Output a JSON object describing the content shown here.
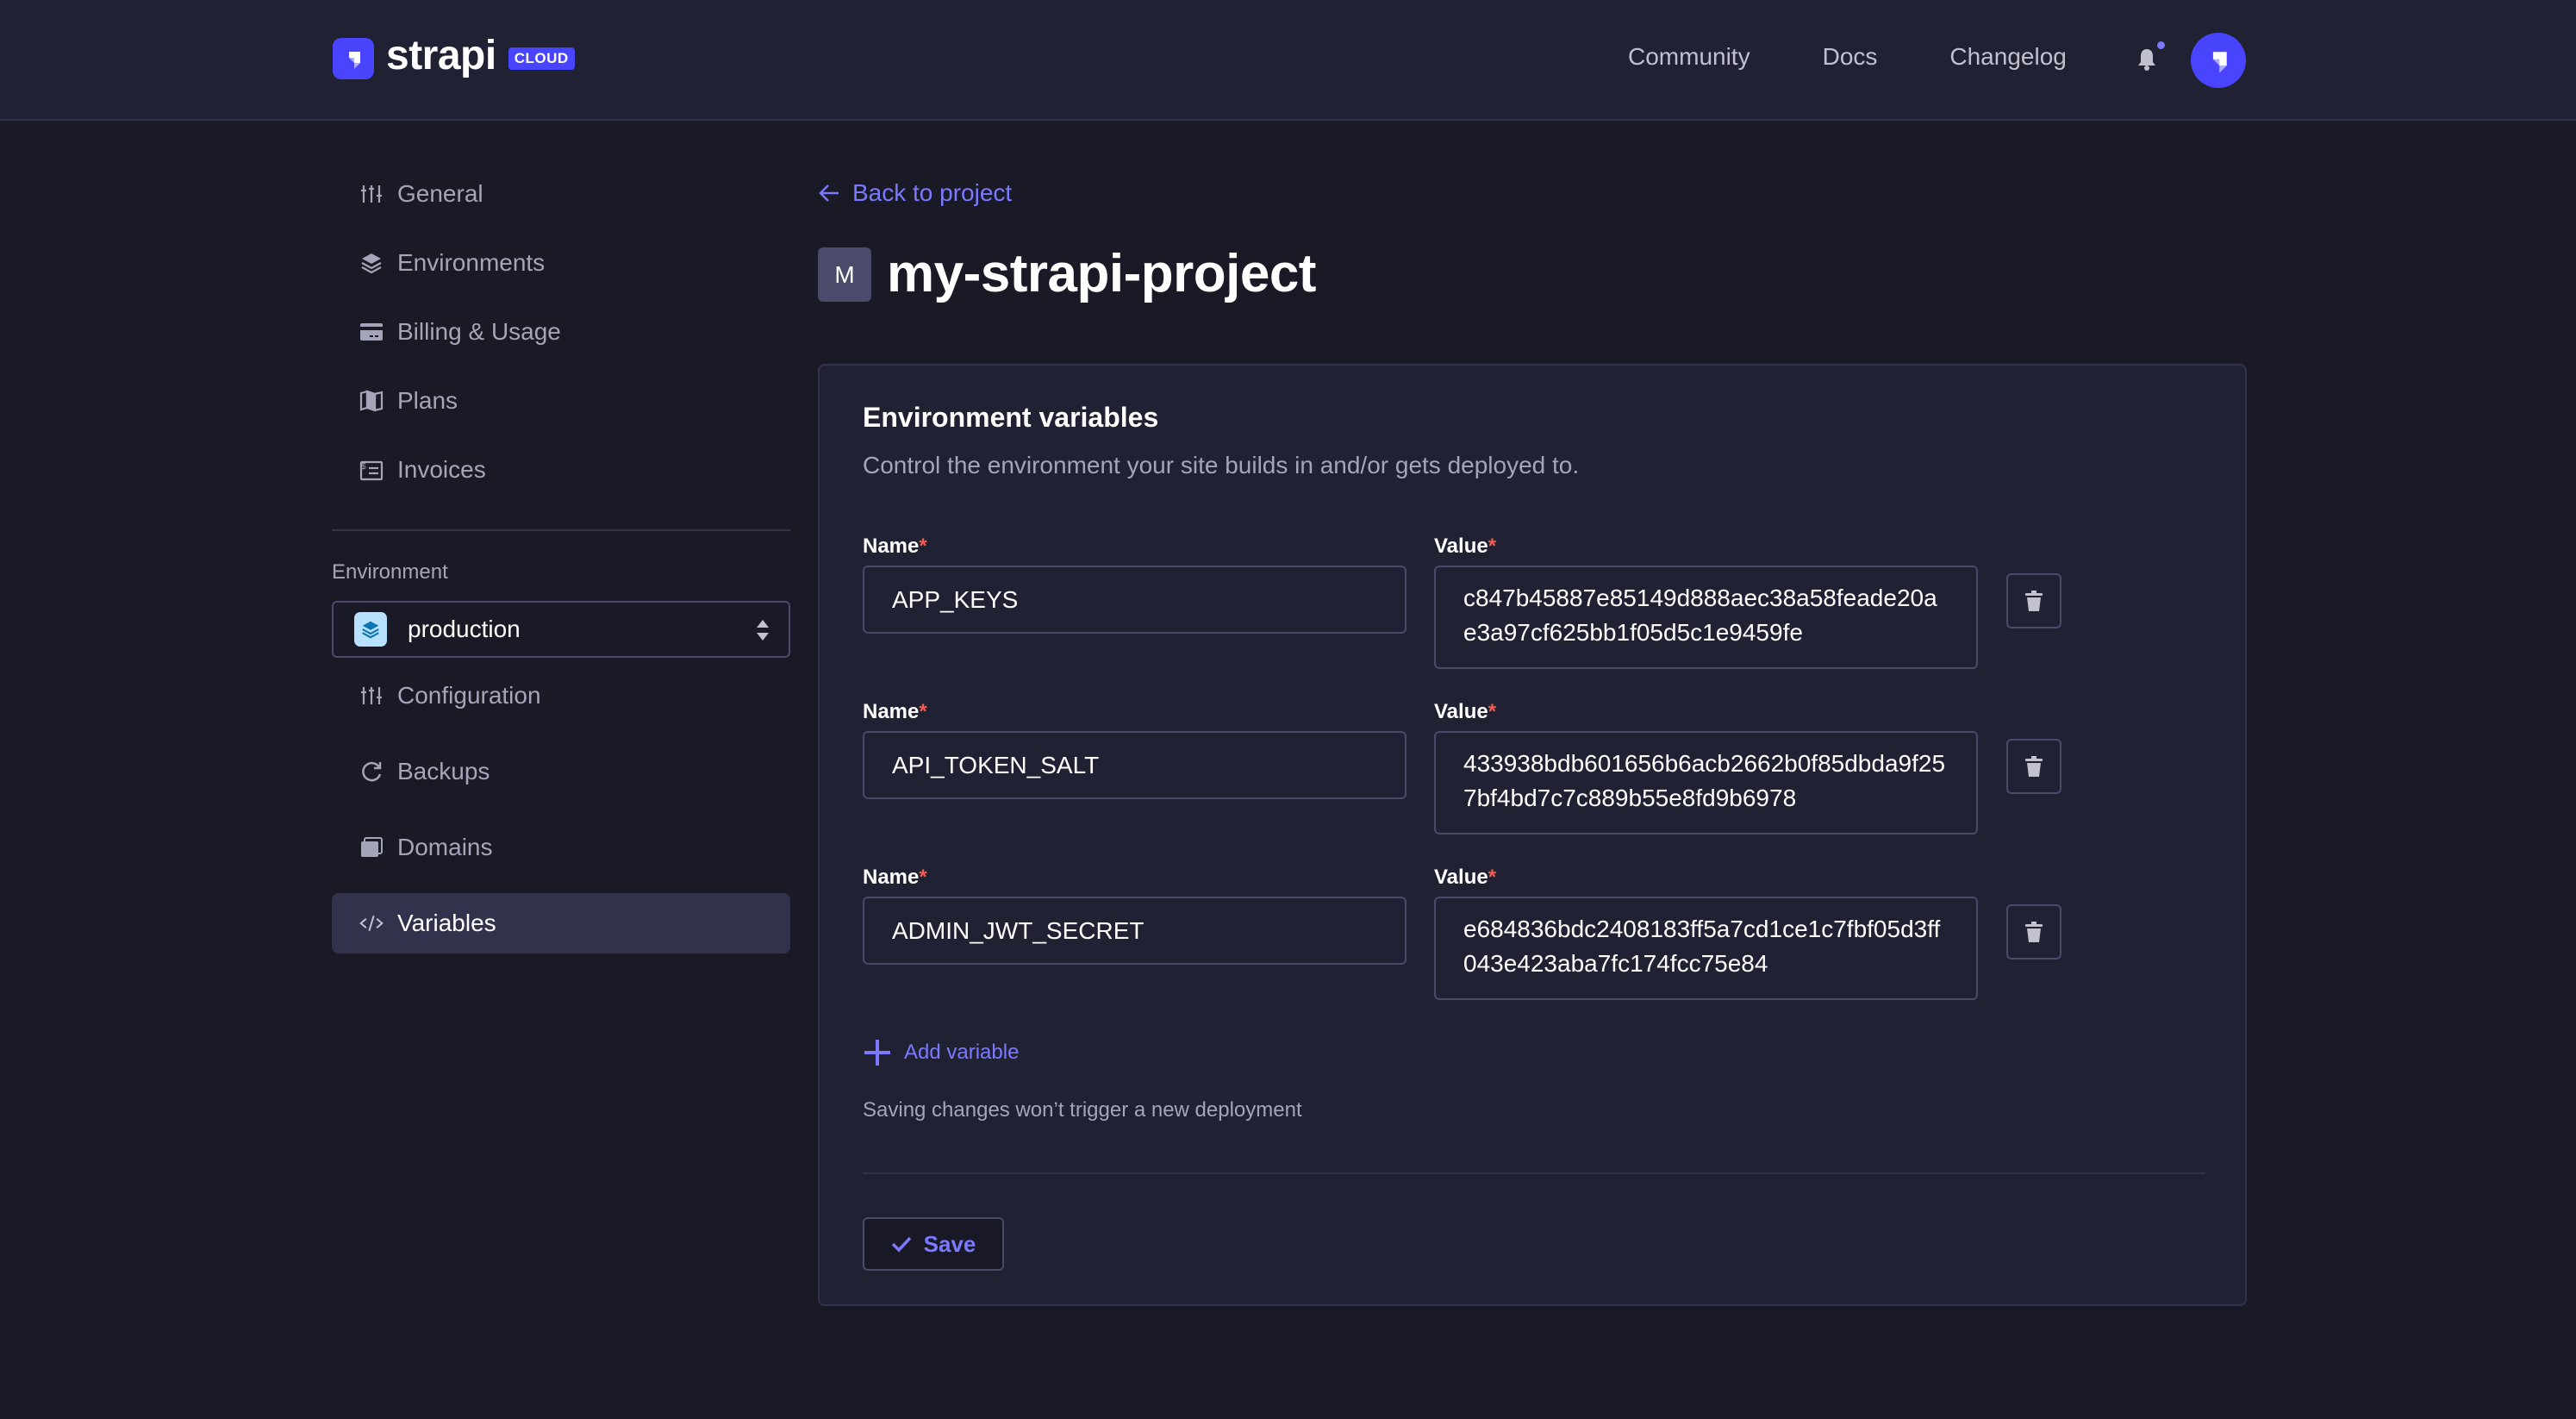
{
  "header": {
    "brand": "strapi",
    "brand_badge": "CLOUD",
    "nav": [
      "Community",
      "Docs",
      "Changelog"
    ],
    "notification_icon": "bell-icon",
    "has_unread_notifications": true,
    "avatar_icon": "strapi-logo-icon"
  },
  "sidebar": {
    "project_items": [
      {
        "label": "General",
        "icon": "sliders-icon"
      },
      {
        "label": "Environments",
        "icon": "layers-icon"
      },
      {
        "label": "Billing & Usage",
        "icon": "credit-card-icon"
      },
      {
        "label": "Plans",
        "icon": "map-icon"
      },
      {
        "label": "Invoices",
        "icon": "invoice-icon"
      }
    ],
    "environment_label": "Environment",
    "environment_value": "production",
    "environment_items": [
      {
        "label": "Configuration",
        "icon": "sliders-icon"
      },
      {
        "label": "Backups",
        "icon": "refresh-icon"
      },
      {
        "label": "Domains",
        "icon": "window-stack-icon"
      },
      {
        "label": "Variables",
        "icon": "code-icon",
        "active": true
      }
    ]
  },
  "main": {
    "back_link": "Back to project",
    "project_initial": "M",
    "project_name": "my-strapi-project",
    "card": {
      "title": "Environment variables",
      "description": "Control the environment your site builds in and/or gets deployed to.",
      "name_label": "Name",
      "value_label": "Value",
      "required_marker": "*",
      "variables": [
        {
          "name": "APP_KEYS",
          "value": "c847b45887e85149d888aec38a58feade20ae3a97cf625bb1f05d5c1e9459fe"
        },
        {
          "name": "API_TOKEN_SALT",
          "value": "433938bdb601656b6acb2662b0f85dbda9f257bf4bd7c7c889b55e8fd9b6978"
        },
        {
          "name": "ADMIN_JWT_SECRET",
          "value": "e684836bdc2408183ff5a7cd1ce1c7fbf05d3ff043e423aba7fc174fcc75e84"
        }
      ],
      "add_variable_label": "Add variable",
      "save_note": "Saving changes won’t trigger a new deployment",
      "save_label": "Save"
    }
  },
  "colors": {
    "accent": "#4945ff",
    "link": "#7b79ff",
    "required": "#ee5e52",
    "background": "#1a1a27",
    "surface": "#212134",
    "border": "#4a4a6a",
    "active_item": "#32324d"
  }
}
